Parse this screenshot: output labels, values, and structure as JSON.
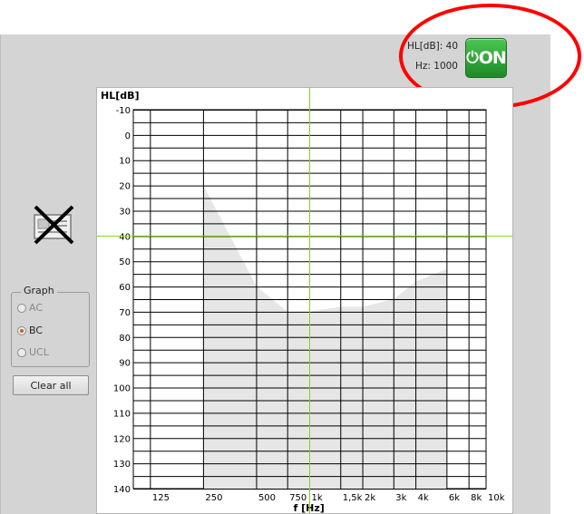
{
  "readout": {
    "hl": "HL[dB]: 40",
    "hz": "Hz: 1000"
  },
  "on_button": {
    "label": "ON",
    "color": "#2ca532"
  },
  "annotation": {
    "color": "#ff0000"
  },
  "patient_icon": {
    "icon": "patient-card-icon",
    "state": "crossed-out"
  },
  "graph_group": {
    "title": "Graph",
    "options": [
      {
        "label": "AC",
        "checked": false,
        "enabled": false
      },
      {
        "label": "BC",
        "checked": true,
        "enabled": true
      },
      {
        "label": "UCL",
        "checked": false,
        "enabled": false
      }
    ]
  },
  "clear_all_label": "Clear all",
  "chart_data": {
    "type": "line",
    "ylabel": "HL[dB]",
    "xlabel": "f [Hz]",
    "y_ticks": [
      -10,
      0,
      10,
      20,
      30,
      40,
      50,
      60,
      70,
      80,
      90,
      100,
      110,
      120,
      130,
      140
    ],
    "ylim": [
      -10,
      140
    ],
    "y_inverted": true,
    "x_scale": "log",
    "x_ticks": [
      {
        "value": 125,
        "label": "125"
      },
      {
        "value": 250,
        "label": "250"
      },
      {
        "value": 500,
        "label": "500"
      },
      {
        "value": 750,
        "label": "750"
      },
      {
        "value": 1000,
        "label": "1k"
      },
      {
        "value": 1500,
        "label": "1,5k"
      },
      {
        "value": 2000,
        "label": "2k"
      },
      {
        "value": 3000,
        "label": "3k"
      },
      {
        "value": 4000,
        "label": "4k"
      },
      {
        "value": 6000,
        "label": "6k"
      },
      {
        "value": 8000,
        "label": "8k"
      },
      {
        "value": 10000,
        "label": "10k"
      }
    ],
    "xlim": [
      100,
      10000
    ],
    "grid": true,
    "cursor": {
      "x": 1000,
      "y": 40,
      "color": "#7ed321"
    },
    "range_shade": {
      "color": "#e6e6e6",
      "top": [
        [
          250,
          20
        ],
        [
          500,
          60
        ],
        [
          750,
          70
        ],
        [
          1000,
          70
        ],
        [
          1500,
          68
        ],
        [
          2000,
          68
        ],
        [
          3000,
          65
        ],
        [
          4000,
          58
        ],
        [
          6000,
          53
        ]
      ],
      "bottom": [
        [
          250,
          140
        ],
        [
          6000,
          140
        ]
      ]
    }
  }
}
